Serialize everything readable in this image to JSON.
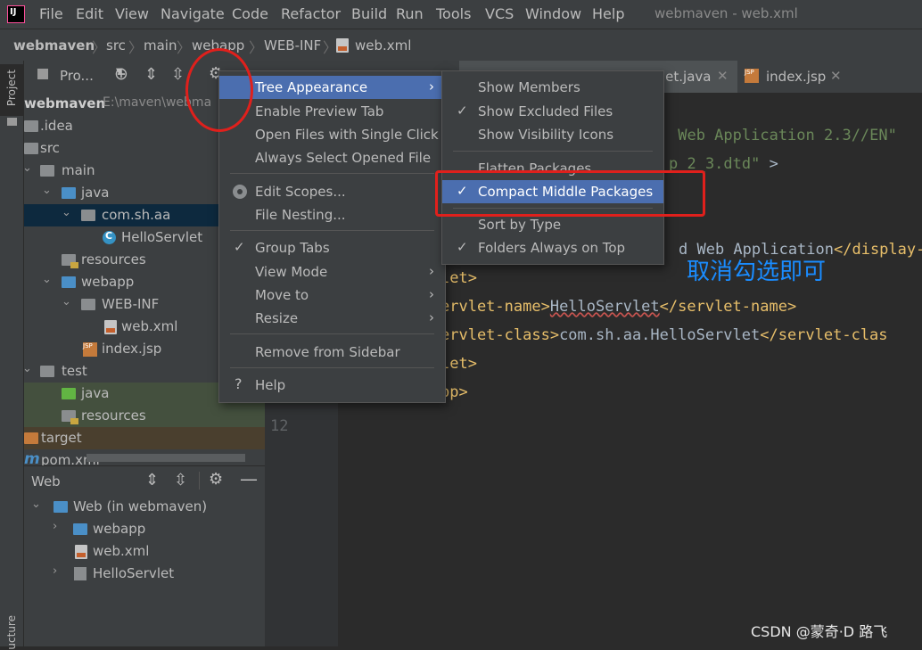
{
  "menubar": {
    "items": [
      "File",
      "Edit",
      "View",
      "Navigate",
      "Code",
      "Refactor",
      "Build",
      "Run",
      "Tools",
      "VCS",
      "Window",
      "Help"
    ],
    "title": "webmaven - web.xml"
  },
  "breadcrumb": [
    "webmaven",
    "src",
    "main",
    "webapp",
    "WEB-INF",
    "web.xml"
  ],
  "project_panel": {
    "dropdown": "Pro...",
    "root_name": "webmaven",
    "root_path": "E:\\maven\\webma",
    "tree": [
      ".idea",
      "src",
      "main",
      "java",
      "com.sh.aa",
      "HelloServlet",
      "resources",
      "webapp",
      "WEB-INF",
      "web.xml",
      "index.jsp",
      "test",
      "java",
      "resources",
      "target",
      "pom.xml"
    ]
  },
  "web_panel": {
    "title": "Web",
    "tree": [
      "Web (in webmaven)",
      "webapp",
      "web.xml",
      "HelloServlet"
    ]
  },
  "side_labels": {
    "project": "Project",
    "structure": "ucture"
  },
  "editor": {
    "tabs": [
      "let.java",
      "index.jsp"
    ],
    "line_number": "12",
    "lines": [
      {
        "parts": [
          {
            "c": "str",
            "t": " Web Application 2.3//EN\""
          }
        ]
      },
      {
        "parts": [
          {
            "c": "str",
            "t": "p_2_3.dtd\" "
          },
          {
            "c": "txt",
            "t": ">"
          }
        ]
      },
      {
        "parts": []
      },
      {
        "parts": []
      },
      {
        "parts": [
          {
            "c": "txt",
            "t": "d Web Application"
          },
          {
            "c": "tag",
            "t": "</display-"
          }
        ]
      },
      {
        "parts": [
          {
            "c": "tag",
            "t": "let>"
          }
        ]
      },
      {
        "parts": [
          {
            "c": "tag",
            "t": "ervlet-name>"
          },
          {
            "c": "txt squig",
            "t": "HelloServlet"
          },
          {
            "c": "tag",
            "t": "</servlet-name>"
          }
        ]
      },
      {
        "parts": [
          {
            "c": "tag",
            "t": "ervlet-class>"
          },
          {
            "c": "txt",
            "t": "com.sh.aa.HelloServlet"
          },
          {
            "c": "tag",
            "t": "</servlet-clas"
          }
        ]
      },
      {
        "parts": [
          {
            "c": "tag",
            "t": "let>"
          }
        ]
      },
      {
        "parts": [
          {
            "c": "tag",
            "t": "pp>"
          }
        ]
      }
    ]
  },
  "context_menu": {
    "items": [
      "Tree Appearance",
      "Enable Preview Tab",
      "Open Files with Single Click",
      "Always Select Opened File",
      "Edit Scopes...",
      "File Nesting...",
      "Group Tabs",
      "View Mode",
      "Move to",
      "Resize",
      "Remove from Sidebar",
      "Help"
    ]
  },
  "submenu": {
    "items": [
      "Show Members",
      "Show Excluded Files",
      "Show Visibility Icons",
      "Flatten Packages",
      "Compact Middle Packages",
      "Sort by Type",
      "Folders Always on Top"
    ]
  },
  "annotation": {
    "note": "取消勾选即可",
    "watermark": "CSDN @蒙奇·D 路飞"
  },
  "colors": {
    "accent": "#4b6eaf",
    "annotation_red": "#e0201c",
    "annotation_blue": "#1a8cff"
  }
}
